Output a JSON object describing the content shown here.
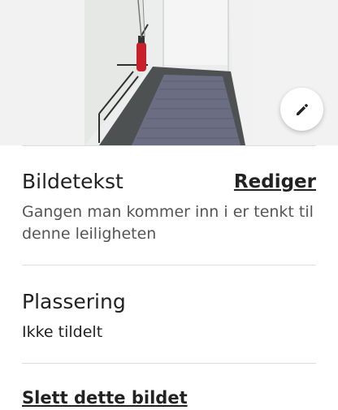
{
  "photo": {
    "alt": "Gangen man kommer inn i er tenkt til denne leiligheten"
  },
  "edit_fab": {
    "icon": "pencil-icon"
  },
  "caption": {
    "title": "Bildetekst",
    "edit_label": "Rediger",
    "text": "Gangen man kommer inn i er tenkt til denne leiligheten"
  },
  "location": {
    "title": "Plassering",
    "value": "Ikke tildelt"
  },
  "delete": {
    "label": "Slett dette bildet"
  }
}
